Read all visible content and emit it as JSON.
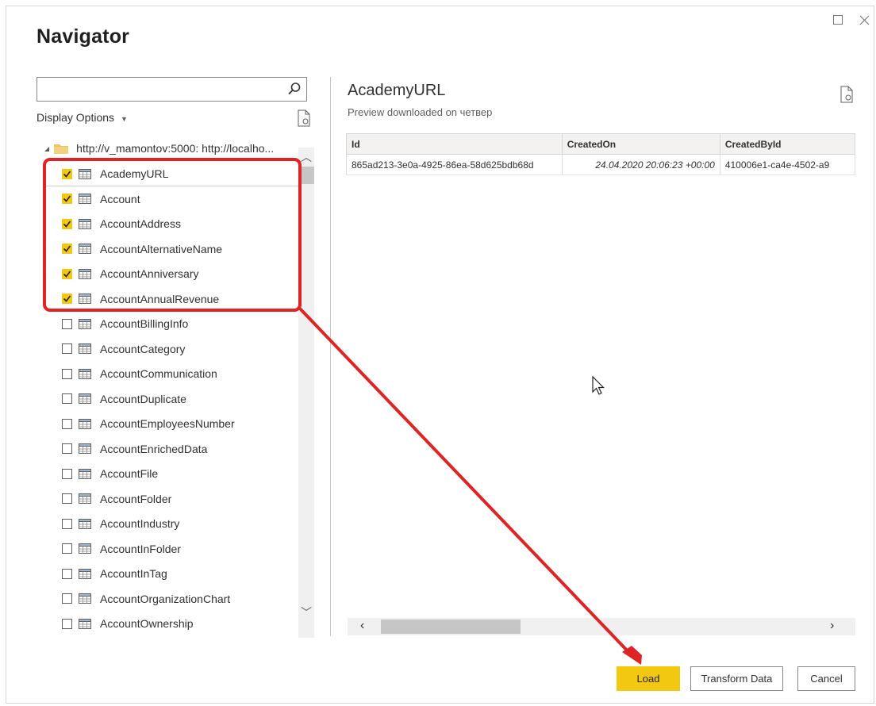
{
  "window": {
    "title": "Navigator",
    "maximize_icon": "maximize-icon",
    "close_icon": "close-icon"
  },
  "search": {
    "value": "",
    "placeholder": ""
  },
  "display_options": {
    "label": "Display Options"
  },
  "tree": {
    "root_label": "http://v_mamontov:5000: http://localho...",
    "items": [
      {
        "label": "AcademyURL",
        "checked": true,
        "selected": true
      },
      {
        "label": "Account",
        "checked": true
      },
      {
        "label": "AccountAddress",
        "checked": true
      },
      {
        "label": "AccountAlternativeName",
        "checked": true
      },
      {
        "label": "AccountAnniversary",
        "checked": true
      },
      {
        "label": "AccountAnnualRevenue",
        "checked": true
      },
      {
        "label": "AccountBillingInfo",
        "checked": false
      },
      {
        "label": "AccountCategory",
        "checked": false
      },
      {
        "label": "AccountCommunication",
        "checked": false
      },
      {
        "label": "AccountDuplicate",
        "checked": false
      },
      {
        "label": "AccountEmployeesNumber",
        "checked": false
      },
      {
        "label": "AccountEnrichedData",
        "checked": false
      },
      {
        "label": "AccountFile",
        "checked": false
      },
      {
        "label": "AccountFolder",
        "checked": false
      },
      {
        "label": "AccountIndustry",
        "checked": false
      },
      {
        "label": "AccountInFolder",
        "checked": false
      },
      {
        "label": "AccountInTag",
        "checked": false
      },
      {
        "label": "AccountOrganizationChart",
        "checked": false
      },
      {
        "label": "AccountOwnership",
        "checked": false
      }
    ]
  },
  "preview": {
    "title": "AcademyURL",
    "subtitle": "Preview downloaded on четвер",
    "columns": [
      "Id",
      "CreatedOn",
      "CreatedById"
    ],
    "rows": [
      [
        "865ad213-3e0a-4925-86ea-58d625bdb68d",
        "24.04.2020 20:06:23 +00:00",
        "410006e1-ca4e-4502-a9"
      ]
    ]
  },
  "buttons": {
    "load": "Load",
    "transform": "Transform Data",
    "cancel": "Cancel"
  },
  "colors": {
    "accent": "#f2c811",
    "annotation": "#e02424"
  }
}
